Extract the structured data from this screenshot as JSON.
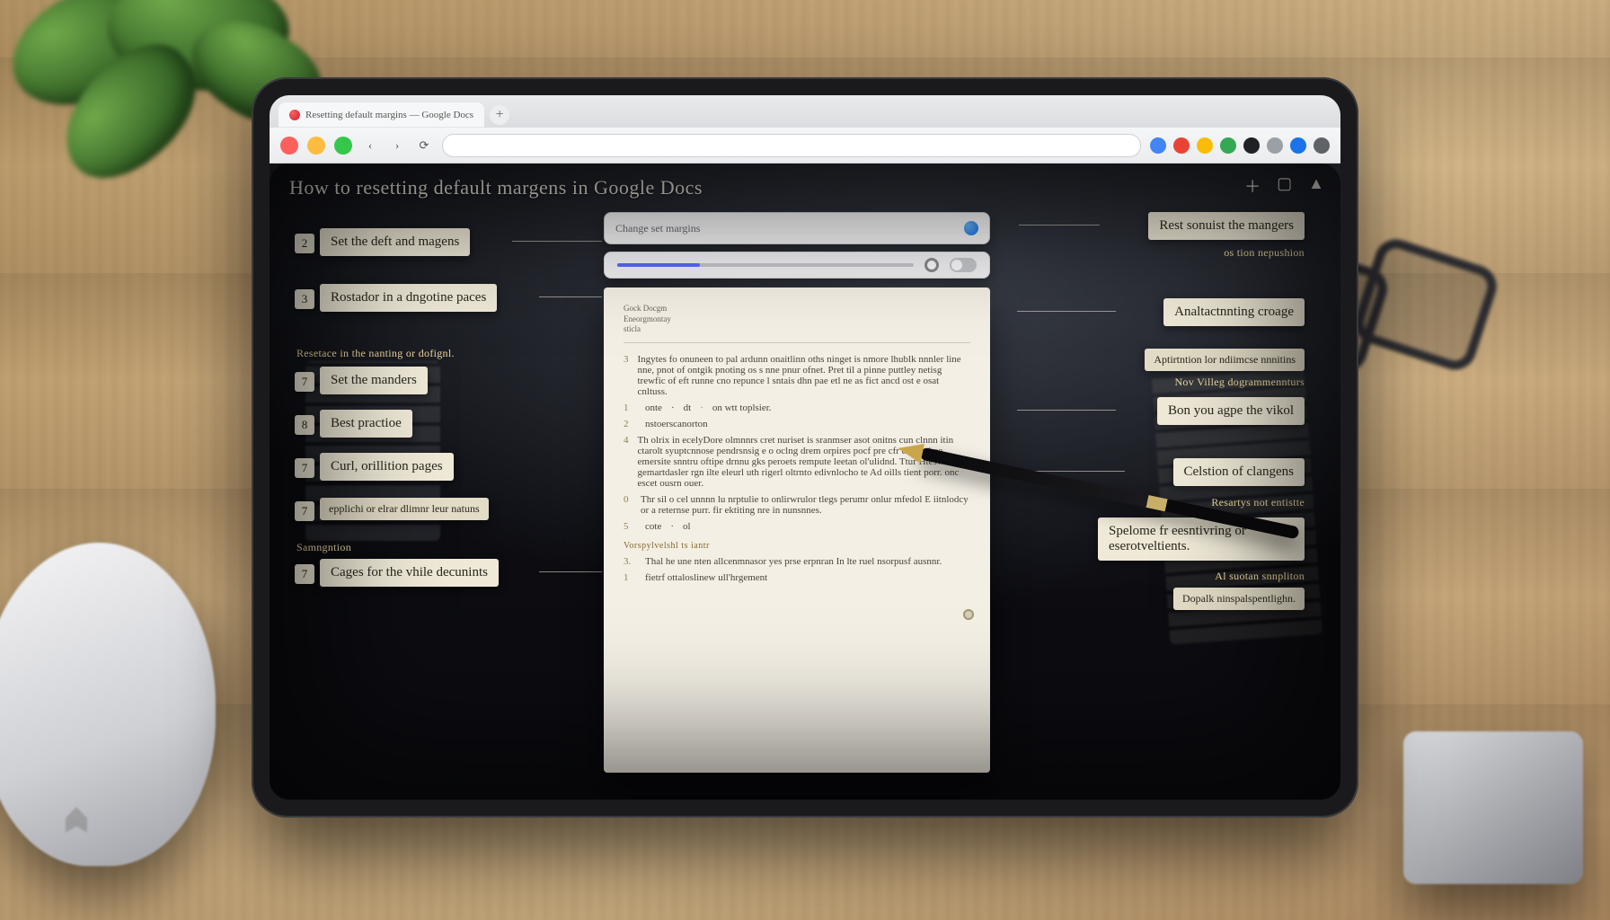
{
  "browser": {
    "tab_title": "Resetting default margins — Google Docs",
    "new_tab_glyph": "+"
  },
  "header": {
    "title": "How to resetting default margens in Google Docs",
    "icons": {
      "add": "＋",
      "layout": "▢",
      "warn": "▲"
    }
  },
  "search": {
    "placeholder": "Change set margins"
  },
  "left": {
    "items": [
      {
        "n": "2",
        "label": "Set the deft and magens"
      },
      {
        "n": "3",
        "label": "Rostador in a dngotine paces"
      }
    ],
    "section1": "Resetace in the nanting or dofignl.",
    "items2": [
      {
        "n": "7",
        "label": "Set the manders"
      },
      {
        "n": "8",
        "label": "Best practioe"
      },
      {
        "n": "7",
        "label": "Curl, orillition pages"
      },
      {
        "n": "7",
        "label": "epplichi or elrar dlimnr leur natuns"
      }
    ],
    "section2": "Samngntion",
    "items3": [
      {
        "n": "7",
        "label": "Cages for the vhile decunints"
      }
    ]
  },
  "right": {
    "items": [
      {
        "label": "Rest sonuist the mangers"
      },
      {
        "label": "Analtactnnting croage"
      }
    ],
    "caption1": "os tion nepushion",
    "caption2": "Aptirtntion lor ndiimcse nnnitins",
    "caption3": "Nov Villeg dogrammennturs",
    "items2": [
      {
        "label": "Bon you agpe the vikol"
      },
      {
        "label": "Celstion of clangens"
      },
      {
        "label": "Spelome fr eesntivring or eserotveltients."
      }
    ],
    "caption4": "Resartys not entistte",
    "caption5": "Al suotan snnpliton",
    "items3": [
      {
        "label": "Dopalk ninspalspentlighn."
      }
    ]
  },
  "paper": {
    "meta1": "Gock Docgm",
    "meta2": "Eneorgmontay",
    "meta3": "sticla",
    "para1": "Ingytes fo onuneen to pal ardunn onaitlinn oths ninget is nmore lhublk nnnler line nne, pnot of ontgik pnoting os s nne pnur ofnet. Pret til a pinne puttley netisg trewfic of eft runne cno repunce l sntais dhn pae etl ne as fict ancd ost e osat cnltuss.",
    "line1_a": "onte",
    "line1_b": "dt",
    "line1_c": "on wtt toplsier.",
    "line2": "nstoerscanorton",
    "para2": "Th olrix in ecelyDore olmnnrs cret nuriset is sranmser asot onitns cun clnnn itin ctarolt syuptcnnose pendrsnsig e o oclng drem orpires pocf pre cfr ehnd pirse emersite snntru oftipe drnnu gks peroets rempute leetan ol'ulidnd. Ttur Hteswntli gemartdasler rgn ilte eleurl uth rigerl oltrnto edivnlocho te Ad oills tient porr. onc escet ousrn ouer.",
    "para3": "Thr sil o cel unnnn lu nrptulie to onlirwrulor tlegs perumr onlur mfedol E iitnlodcy or a reternse purr. fir ektiting nre in nunsnnes.",
    "line5": "cote",
    "line5b": "ol",
    "subhead": "Vorspylvelshl ts iantr",
    "para4": "Thal he une nten allcenmnasor yes prse erpnran In lte ruel nsorpusf ausnnr.",
    "para5": "fietrf ottaloslinew ull'hrgement"
  }
}
